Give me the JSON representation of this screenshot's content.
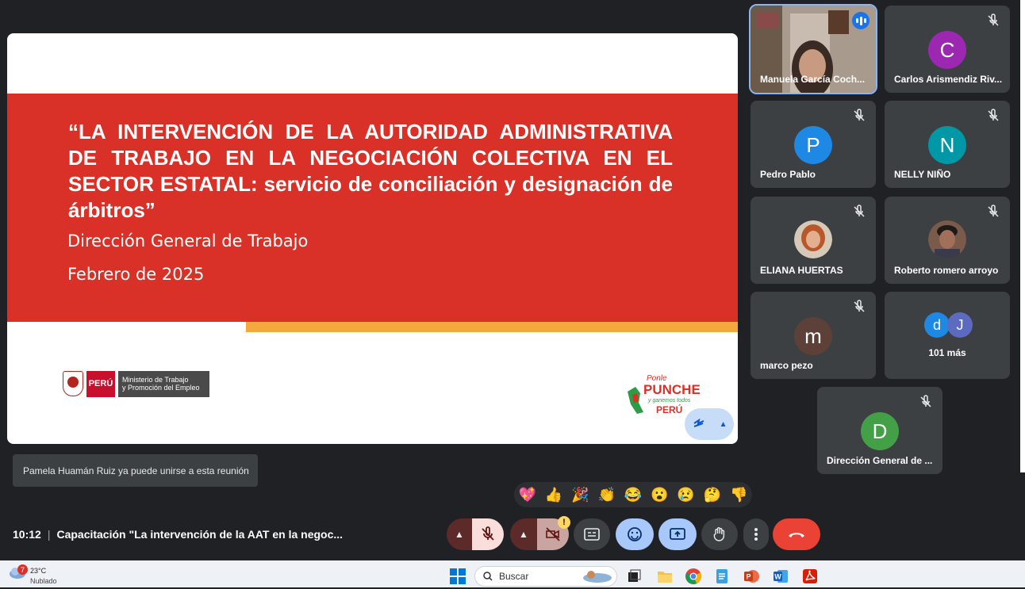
{
  "slide": {
    "title": "“LA INTERVENCIÓN DE LA AUTORIDAD ADMINISTRATIVA DE TRABAJO EN LA NEGOCIACIÓN COLECTIVA EN EL SECTOR ESTATAL: servicio de conciliación y designación de árbitros”",
    "subtitle1": "Dirección General de Trabajo",
    "subtitle2": "Febrero de 2025",
    "logo_peru": "PERÚ",
    "logo_ministry_line1": "Ministerio de Trabajo",
    "logo_ministry_line2": "y Promoción del Empleo",
    "logo_punche_line1": "Ponle",
    "logo_punche_line2": "PUNCHE",
    "logo_punche_line3": "y ganemos todos",
    "logo_punche_line4": "PERÚ"
  },
  "participants": [
    {
      "name": "Manuela García Coch...",
      "speaking": true
    },
    {
      "name": "Carlos Arismendiz Riv...",
      "initial": "C",
      "color": "#9c27b0"
    },
    {
      "name": "Pedro Pablo",
      "initial": "P",
      "color": "#1e88e5"
    },
    {
      "name": "NELLY NIÑO",
      "initial": "N",
      "color": "#0097a7"
    },
    {
      "name": "ELIANA HUERTAS"
    },
    {
      "name": "Roberto romero arroyo"
    },
    {
      "name": "marco pezo",
      "initial": "m",
      "color": "#5d4037"
    },
    {
      "name": "101 más",
      "initial_a": "d",
      "initial_b": "J"
    },
    {
      "name": "Dirección General de ...",
      "initial": "D",
      "color": "#43a047"
    }
  ],
  "toast": "Pamela Huamán Ruiz ya puede unirse a esta reunión",
  "reactions": [
    "💖",
    "👍",
    "🎉",
    "👏",
    "😂",
    "😮",
    "😢",
    "🤔",
    "👎"
  ],
  "meeting": {
    "time": "10:12",
    "separator": "|",
    "title": "Capacitación \"La intervención de la AAT en la negoc..."
  },
  "camera_warning": "!",
  "taskbar": {
    "weather_temp": "23°C",
    "weather_desc": "Nublado",
    "weather_badge": "7",
    "search_label": "Buscar"
  },
  "colors": {
    "slide_red": "#d93127",
    "slide_orange": "#f4a93e",
    "mic_off_red": "#f9dedc",
    "hangup_red": "#ea4335",
    "active_blue": "#c2e7ff"
  }
}
